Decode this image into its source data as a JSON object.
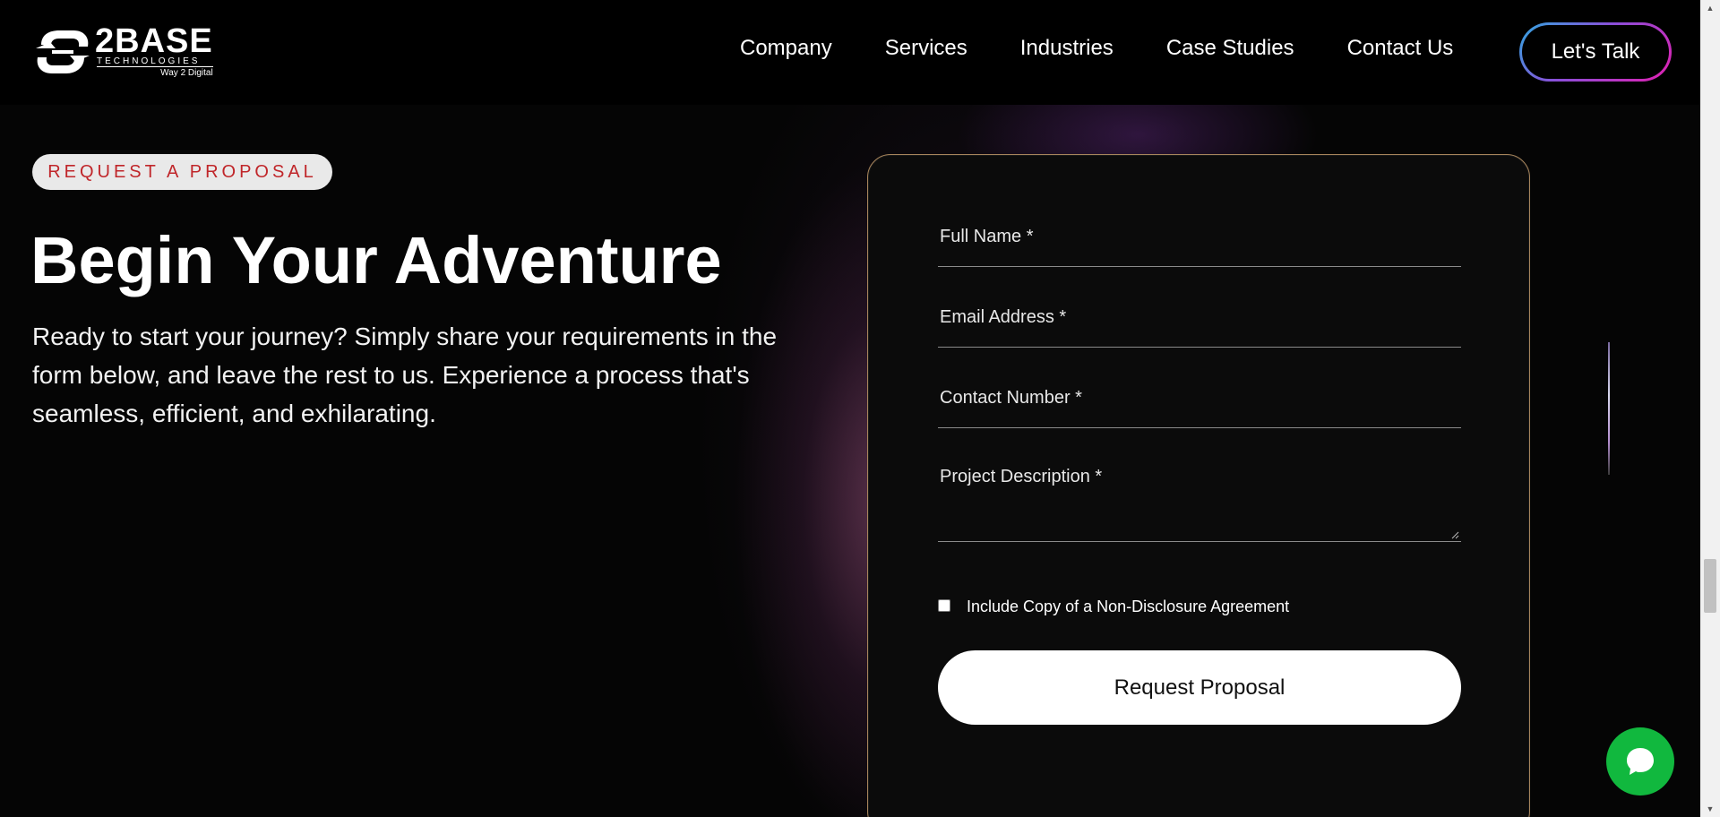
{
  "header": {
    "logo": {
      "brand": "2BASE",
      "subtitle": "TECHNOLOGIES",
      "tagline": "Way 2 Digital"
    },
    "nav": [
      {
        "label": "Company"
      },
      {
        "label": "Services"
      },
      {
        "label": "Industries"
      },
      {
        "label": "Case Studies"
      },
      {
        "label": "Contact Us"
      }
    ],
    "cta_label": "Let's Talk"
  },
  "hero": {
    "pill": "REQUEST A PROPOSAL",
    "headline": "Begin Your Adventure",
    "intro": "Ready to start your journey? Simply share your requirements in the form below, and leave the rest to us. Experience a process that's seamless, efficient, and exhilarating."
  },
  "form": {
    "full_name_label": "Full Name *",
    "email_label": "Email Address *",
    "contact_label": "Contact Number *",
    "description_label": "Project Description *",
    "nda_label": "Include Copy of a Non-Disclosure Agreement",
    "nda_checked": false,
    "submit_label": "Request Proposal"
  },
  "colors": {
    "accent_red": "#c0262a",
    "chat_green": "#11b83e",
    "cta_gradient_start": "#2fa8e0",
    "cta_gradient_end": "#e21fb0",
    "card_border": "#a7855c"
  },
  "icons": {
    "logo": "2base-logo-icon",
    "chat": "chat-bubble-icon"
  }
}
